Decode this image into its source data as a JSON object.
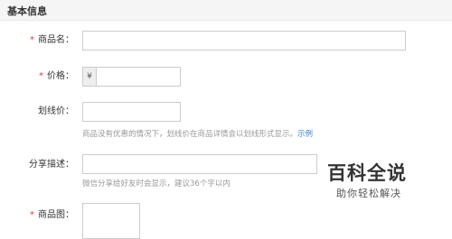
{
  "section": {
    "title": "基本信息"
  },
  "fields": {
    "name": {
      "required": "*",
      "label": "商品名：",
      "value": ""
    },
    "price": {
      "required": "*",
      "label": "价格：",
      "currency": "¥",
      "value": ""
    },
    "strike_price": {
      "label": "划线价：",
      "value": "",
      "help": "商品没有优惠的情况下，划线价在商品详情会以划线形式显示。",
      "help_link": "示例"
    },
    "share_desc": {
      "label": "分享描述：",
      "value": "",
      "help": "微信分享给好友时会显示，建议36个字以内"
    },
    "image": {
      "required": "*",
      "label": "商品图："
    }
  },
  "watermark": {
    "title": "百科全说",
    "subtitle": "助你轻松解决"
  },
  "colors": {
    "required": "#e4393c",
    "link": "#3a7bd5",
    "help_text": "#999999",
    "header_bg": "#f5f5f5"
  }
}
